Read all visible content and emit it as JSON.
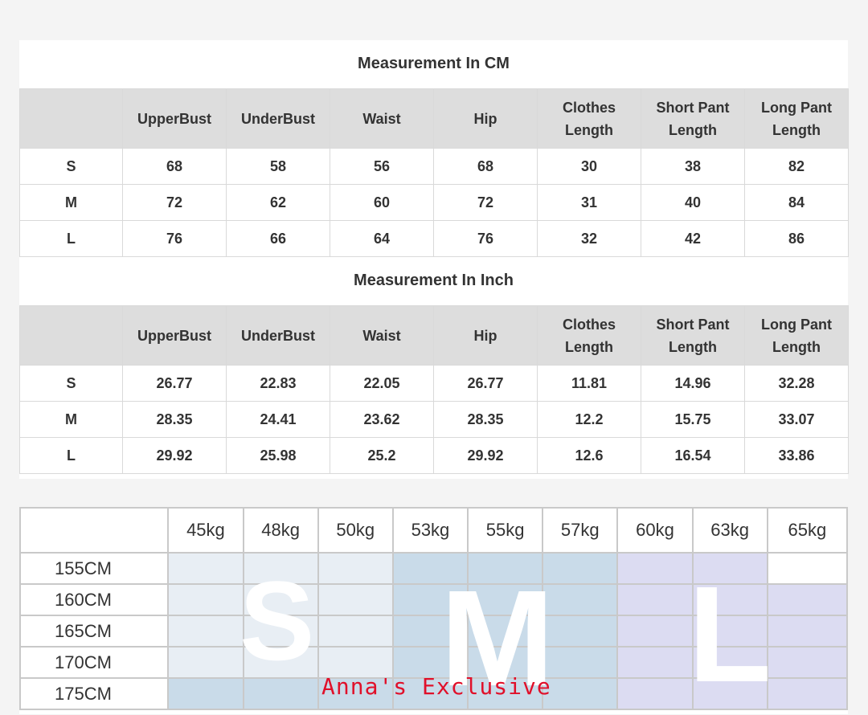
{
  "cm_section": {
    "title": "Measurement In CM",
    "headers": [
      "",
      "UpperBust",
      "UnderBust",
      "Waist",
      "Hip",
      [
        "Clothes",
        "Length"
      ],
      [
        "Short Pant",
        "Length"
      ],
      [
        "Long Pant",
        "Length"
      ]
    ],
    "rows": [
      [
        "S",
        "68",
        "58",
        "56",
        "68",
        "30",
        "38",
        "82"
      ],
      [
        "M",
        "72",
        "62",
        "60",
        "72",
        "31",
        "40",
        "84"
      ],
      [
        "L",
        "76",
        "66",
        "64",
        "76",
        "32",
        "42",
        "86"
      ]
    ]
  },
  "inch_section": {
    "title": "Measurement In Inch",
    "headers": [
      "",
      "UpperBust",
      "UnderBust",
      "Waist",
      "Hip",
      [
        "Clothes",
        "Length"
      ],
      [
        "Short Pant",
        "Length"
      ],
      [
        "Long Pant",
        "Length"
      ]
    ],
    "rows": [
      [
        "S",
        "26.77",
        "22.83",
        "22.05",
        "26.77",
        "11.81",
        "14.96",
        "32.28"
      ],
      [
        "M",
        "28.35",
        "24.41",
        "23.62",
        "28.35",
        "12.2",
        "15.75",
        "33.07"
      ],
      [
        "L",
        "29.92",
        "25.98",
        "25.2",
        "29.92",
        "12.6",
        "16.54",
        "33.86"
      ]
    ]
  },
  "size_grid": {
    "weights": [
      "45kg",
      "48kg",
      "50kg",
      "53kg",
      "55kg",
      "57kg",
      "60kg",
      "63kg",
      "65kg"
    ],
    "heights": [
      "155CM",
      "160CM",
      "165CM",
      "170CM",
      "175CM"
    ],
    "size_letters": [
      "S",
      "M",
      "L"
    ],
    "colors": {
      "S": "#e8eef4",
      "M": "#c9dbe9",
      "L": "#dcdcf2"
    }
  },
  "watermark": "Anna's Exclusive"
}
